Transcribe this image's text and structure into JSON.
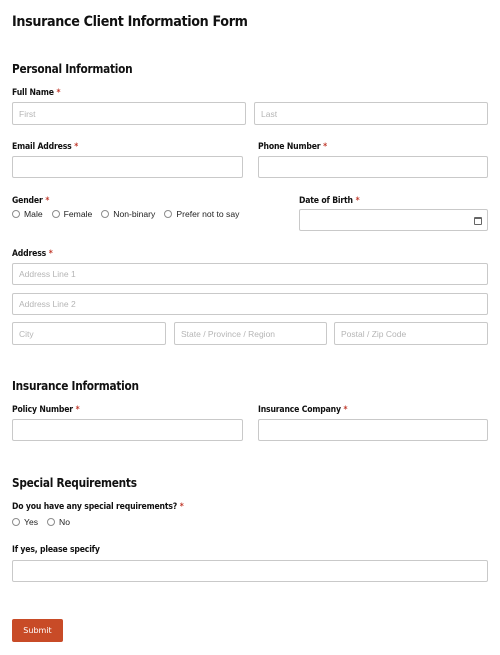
{
  "form": {
    "title": "Insurance Client Information Form",
    "required_marker": "*",
    "personal": {
      "heading": "Personal Information",
      "full_name_label": "Full Name",
      "first_placeholder": "First",
      "last_placeholder": "Last",
      "email_label": "Email Address",
      "phone_label": "Phone Number",
      "gender_label": "Gender",
      "gender_options": [
        "Male",
        "Female",
        "Non-binary",
        "Prefer not to say"
      ],
      "dob_label": "Date of Birth",
      "address_label": "Address",
      "address_line1_placeholder": "Address Line 1",
      "address_line2_placeholder": "Address Line 2",
      "city_placeholder": "City",
      "state_placeholder": "State / Province / Region",
      "zip_placeholder": "Postal / Zip Code"
    },
    "insurance": {
      "heading": "Insurance Information",
      "policy_label": "Policy Number",
      "company_label": "Insurance Company"
    },
    "special": {
      "heading": "Special Requirements",
      "question_label": "Do you have any special requirements?",
      "options": [
        "Yes",
        "No"
      ],
      "specify_label": "If yes, please specify"
    },
    "submit_label": "Submit",
    "colors": {
      "required": "#c0392b",
      "submit_bg": "#c84b27",
      "input_border": "#c9c9c9"
    }
  }
}
